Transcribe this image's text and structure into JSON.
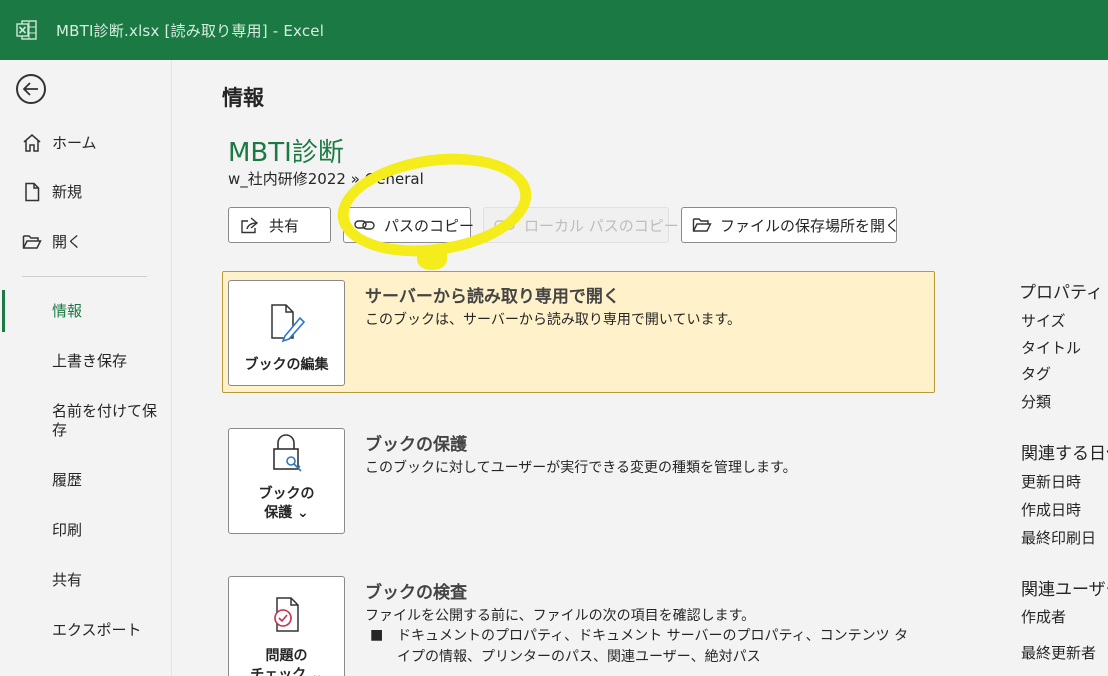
{
  "titlebar": {
    "title": "MBTI診断.xlsx  [読み取り専用]  -  Excel",
    "app_icon": "excel-icon",
    "bg_color": "#1b7a43"
  },
  "sidebar": {
    "back_icon": "back-arrow-icon",
    "home": "ホーム",
    "new": "新規",
    "open": "開く",
    "info": "情報",
    "save": "上書き保存",
    "save_as": "名前を付けて保存",
    "history": "履歴",
    "print": "印刷",
    "share": "共有",
    "export": "エクスポート"
  },
  "main": {
    "page_title": "情報",
    "doc_title": "MBTI診断",
    "doc_path": "w_社内研修2022 » General",
    "buttons": {
      "share": "共有",
      "copy_path": "パスのコピー",
      "copy_local_path": "ローカル パスのコピー",
      "open_location": "ファイルの保存場所を開く"
    },
    "sections": {
      "edit": {
        "tile_label": "ブックの編集",
        "heading": "サーバーから読み取り専用で開く",
        "desc": "このブックは、サーバーから読み取り専用で開いています。"
      },
      "protect": {
        "tile_label_1": "ブックの",
        "tile_label_2": "保護 ⌄",
        "heading": "ブックの保護",
        "desc": "このブックに対してユーザーが実行できる変更の種類を管理します。"
      },
      "inspect": {
        "tile_label_1": "問題の",
        "tile_label_2": "チェック ⌄",
        "heading": "ブックの検査",
        "desc": "ファイルを公開する前に、ファイルの次の項目を確認します。",
        "bullet": "ドキュメントのプロパティ、ドキュメント サーバーのプロパティ、コンテンツ タイプの情報、プリンターのパス、関連ユーザー、絶対パス"
      }
    }
  },
  "properties": {
    "heading": "プロパティ ⌄",
    "items": [
      "サイズ",
      "タイトル",
      "タグ",
      "分類"
    ],
    "dates_heading": "関連する日付",
    "dates": [
      "更新日時",
      "作成日時",
      "最終印刷日"
    ],
    "users_heading": "関連ユーザー",
    "users": [
      "作成者",
      "最終更新者"
    ]
  },
  "annotation_color": "#f5ec1b"
}
